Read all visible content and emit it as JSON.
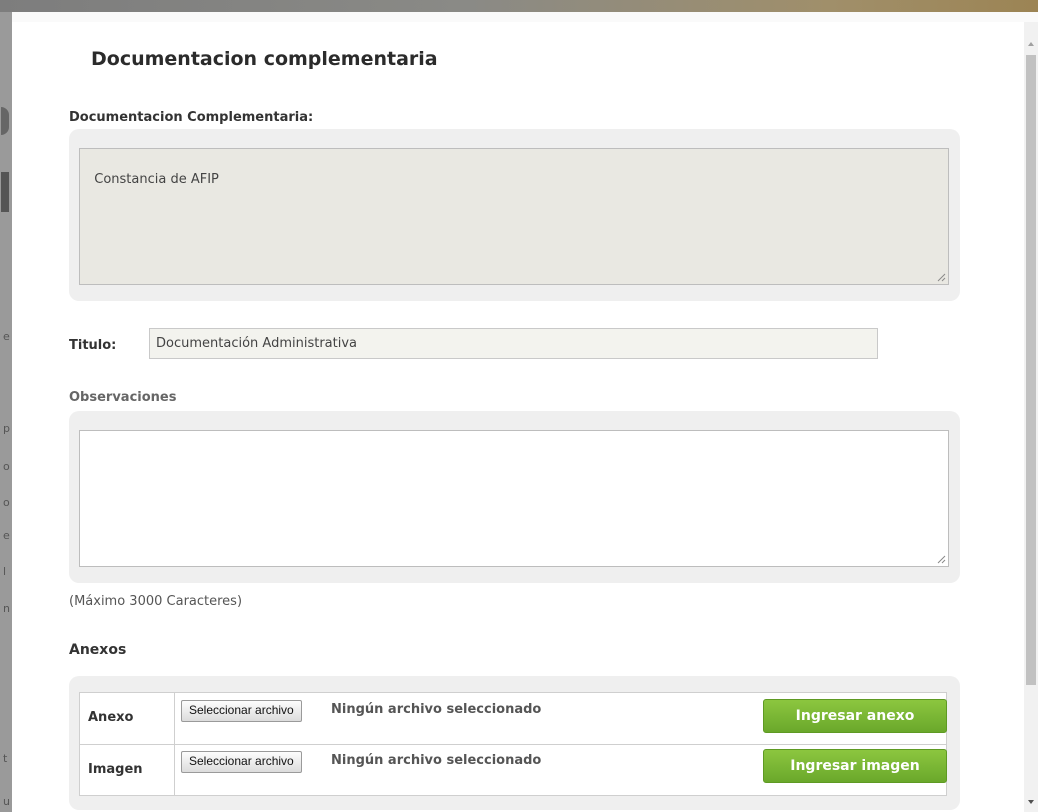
{
  "modal": {
    "title": "Documentacion complementaria"
  },
  "doc_complementaria": {
    "label": "Documentacion Complementaria:",
    "value": "Constancia de AFIP"
  },
  "titulo": {
    "label": "Titulo:",
    "value": "Documentación Administrativa"
  },
  "observaciones": {
    "label": "Observaciones",
    "value": "",
    "hint": "(Máximo 3000 Caracteres)"
  },
  "anexos": {
    "heading": "Anexos",
    "rows": [
      {
        "label": "Anexo",
        "file_button": "Seleccionar archivo",
        "file_status": "Ningún archivo seleccionado",
        "action": "Ingresar anexo"
      },
      {
        "label": "Imagen",
        "file_button": "Seleccionar archivo",
        "file_status": "Ningún archivo seleccionado",
        "action": "Ingresar imagen"
      }
    ]
  },
  "colors": {
    "accent_green": "#7ab737",
    "panel_bg": "#efefef",
    "readonly_bg": "#e9e8e2"
  }
}
